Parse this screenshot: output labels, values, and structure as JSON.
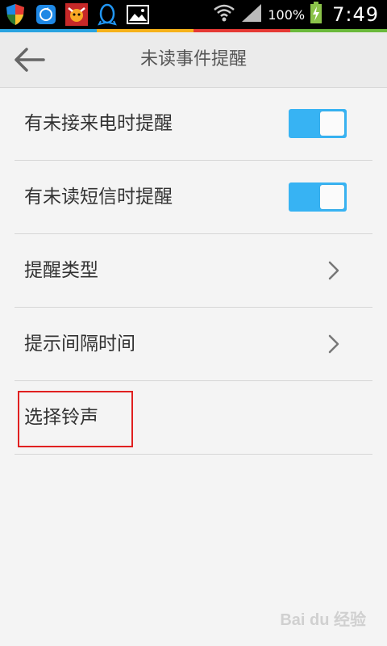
{
  "status_bar": {
    "battery_percent": "100%",
    "time": "7:49",
    "left_icons": [
      "shield-icon",
      "sync-icon",
      "cow-app-icon",
      "qq-penguin-icon",
      "gallery-icon"
    ],
    "right_icons": [
      "wifi-icon",
      "signal-icon",
      "battery-charging-icon"
    ]
  },
  "header": {
    "title": "未读事件提醒",
    "back_icon": "back-arrow-icon"
  },
  "settings": {
    "items": [
      {
        "label": "有未接来电时提醒",
        "type": "toggle",
        "on": true
      },
      {
        "label": "有未读短信时提醒",
        "type": "toggle",
        "on": true
      },
      {
        "label": "提醒类型",
        "type": "chevron"
      },
      {
        "label": "提示间隔时间",
        "type": "chevron"
      },
      {
        "label": "选择铃声",
        "type": "plain"
      }
    ]
  },
  "colors": {
    "toggle_on": "#37b3f3",
    "highlight": "#e02020",
    "background": "#f4f4f4"
  },
  "watermark": {
    "logo_text": "Bai du 经验"
  }
}
